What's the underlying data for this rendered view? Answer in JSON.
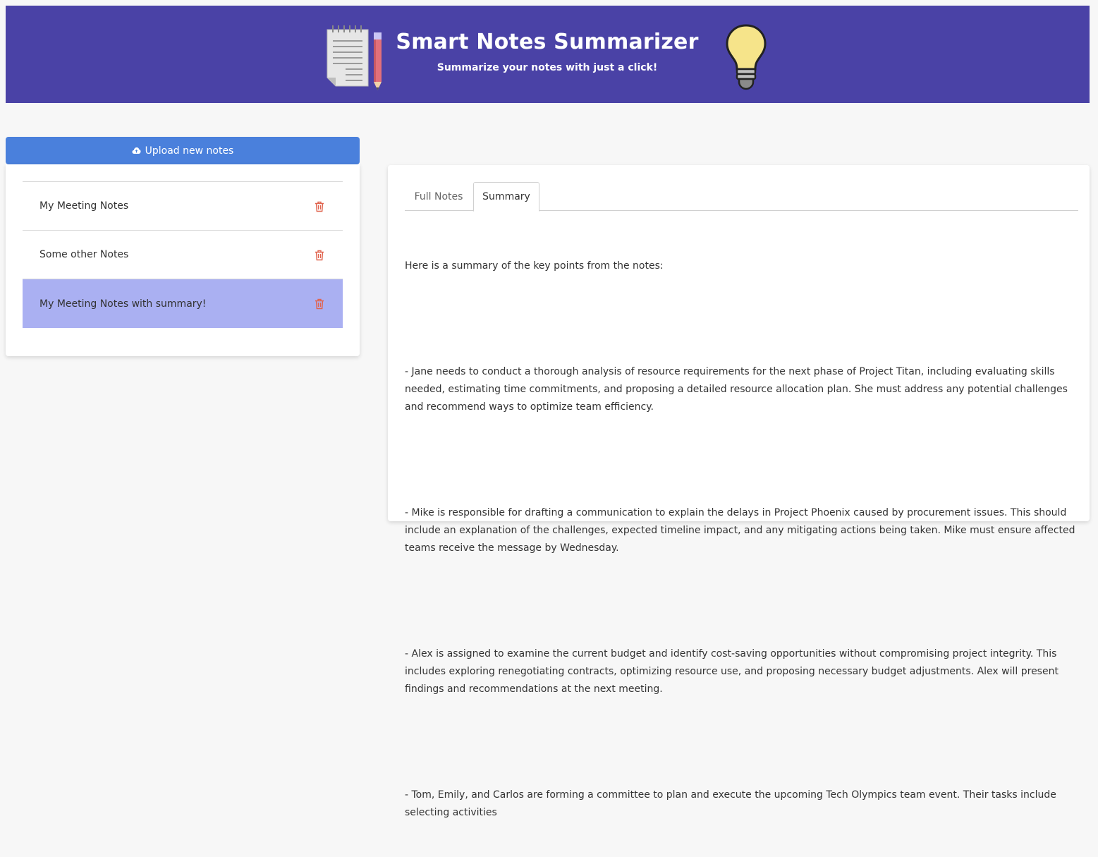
{
  "header": {
    "title": "Smart Notes Summarizer",
    "subtitle": "Summarize your notes with just a click!",
    "left_icon": "notepad-pencil-icon",
    "right_icon": "lightbulb-icon",
    "background_color": "#4a42a6"
  },
  "sidebar": {
    "upload_label": "Upload new notes",
    "upload_icon": "cloud-upload-icon",
    "upload_color": "#4a80dc",
    "notes": [
      {
        "title": "My Meeting Notes",
        "selected": false
      },
      {
        "title": "Some other Notes",
        "selected": false
      },
      {
        "title": "My Meeting Notes with summary!",
        "selected": true
      }
    ],
    "delete_icon": "trash-icon",
    "selected_color": "#aab0f2"
  },
  "main": {
    "tabs": [
      {
        "label": "Full Notes",
        "active": false
      },
      {
        "label": "Summary",
        "active": true
      }
    ],
    "summary_paragraphs": [
      "Here is a summary of the key points from the notes:",
      "- Jane needs to conduct a thorough analysis of resource requirements for the next phase of Project Titan, including evaluating skills needed, estimating time commitments, and proposing a detailed resource allocation plan. She must address any potential challenges and recommend ways to optimize team efficiency.",
      "- Mike is responsible for drafting a communication to explain the delays in Project Phoenix caused by procurement issues. This should include an explanation of the challenges, expected timeline impact, and any mitigating actions being taken. Mike must ensure affected teams receive the message by Wednesday.",
      "- Alex is assigned to examine the current budget and identify cost-saving opportunities without compromising project integrity. This includes exploring renegotiating contracts, optimizing resource use, and proposing necessary budget adjustments. Alex will present findings and recommendations at the next meeting.",
      "- Tom, Emily, and Carlos are forming a committee to plan and execute the upcoming Tech Olympics team event. Their tasks include selecting activities"
    ]
  }
}
